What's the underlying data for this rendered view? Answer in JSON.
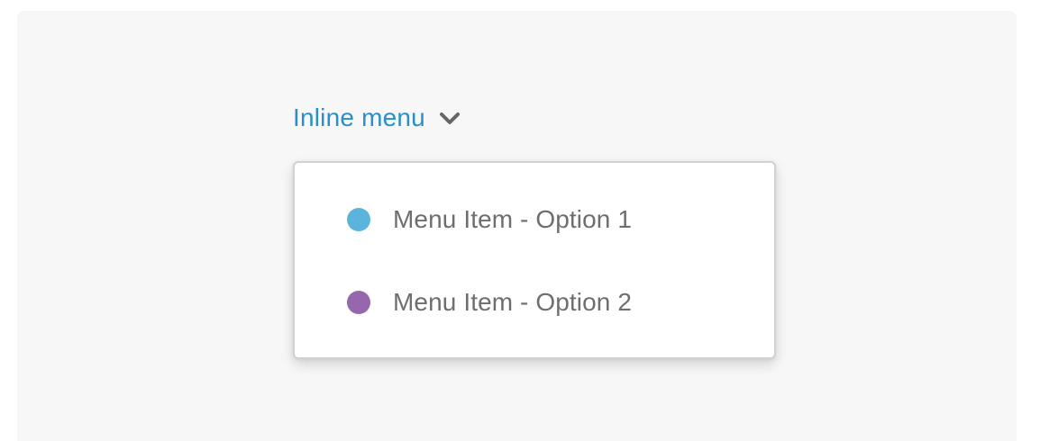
{
  "inline_menu": {
    "trigger_label": "Inline menu",
    "trigger_icon": "chevron-down-icon",
    "accent_color": "#2a8fc8",
    "items": [
      {
        "label": "Menu Item - Option 1",
        "dot_color": "#5ab4dc"
      },
      {
        "label": "Menu Item - Option 2",
        "dot_color": "#9767ad"
      }
    ]
  }
}
